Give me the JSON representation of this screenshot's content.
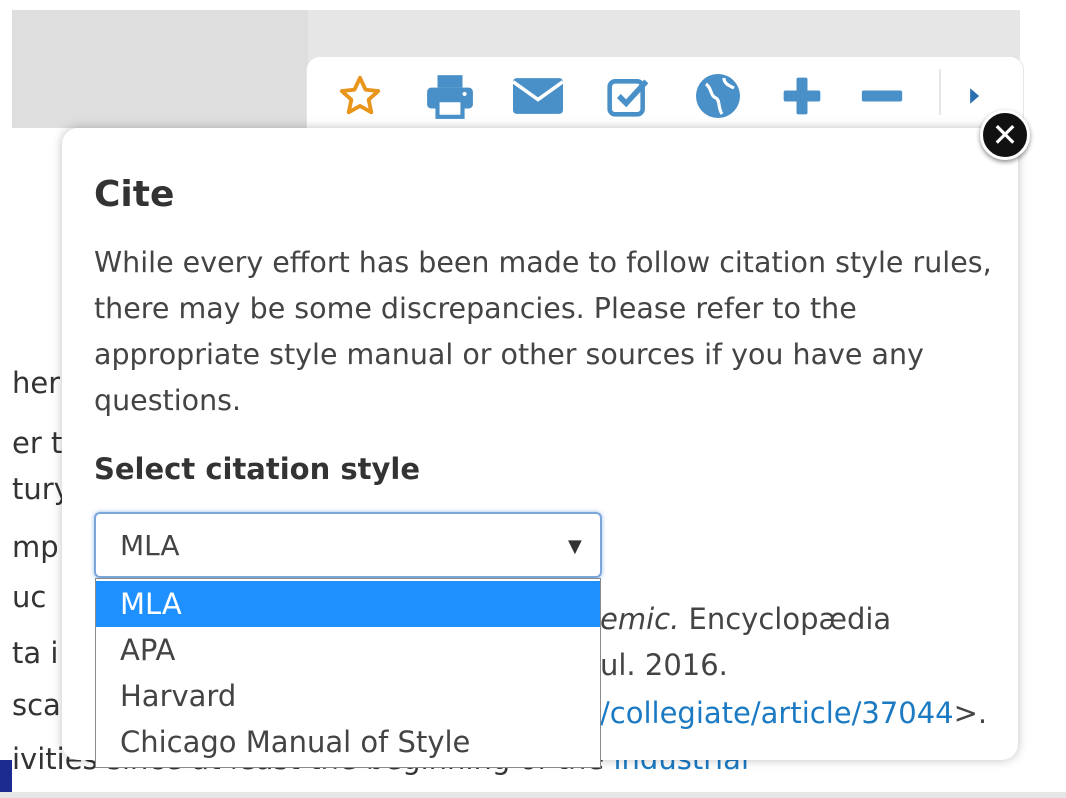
{
  "toolbar": {
    "icons": [
      "star-icon",
      "print-icon",
      "email-icon",
      "checkbox-icon",
      "globe-icon",
      "plus-icon",
      "minus-icon",
      "more-arrow-icon"
    ]
  },
  "article": {
    "fragments": [
      "her",
      "er t",
      "tury",
      "mp",
      "uc",
      "ta i",
      "sca"
    ],
    "bottom_text": "ivities since at least the beginning of the ",
    "bottom_link": "industrial"
  },
  "popup": {
    "title": "Cite",
    "description": "While every effort has been made to follow citation style rules, there may be some discrepancies. Please refer to the appropriate style manual or other sources if you have any questions.",
    "select_label": "Select citation style",
    "select_value": "MLA",
    "options": [
      "MLA",
      "APA",
      "Harvard",
      "Chicago Manual of Style"
    ],
    "citation": {
      "line1_italic": "emic.",
      "line1_rest": " Encyclopædia",
      "line2": "ul. 2016.",
      "line3_link": "/collegiate/article/37044",
      "line3_suffix": ">."
    }
  },
  "colors": {
    "accent": "#1e90ff",
    "icon_blue": "#4a90c8",
    "star_orange": "#e8951c"
  }
}
